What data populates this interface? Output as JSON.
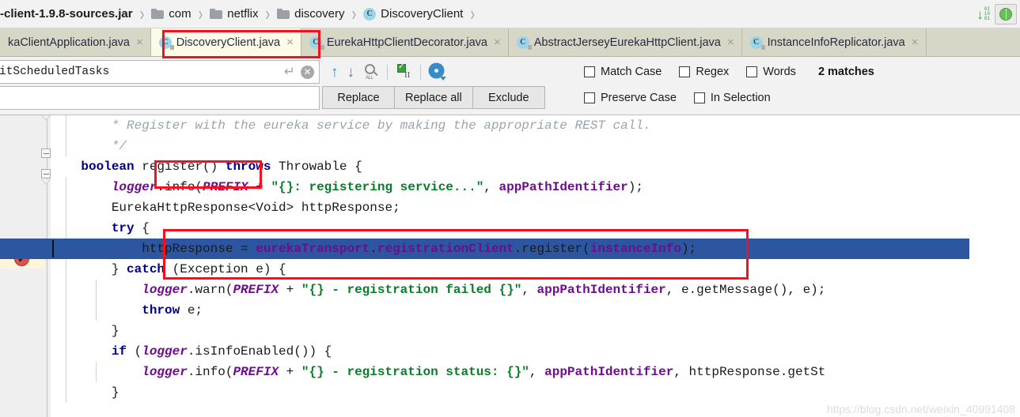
{
  "breadcrumb": {
    "items": [
      {
        "label": "-client-1.9.8-sources.jar",
        "icon": "none"
      },
      {
        "label": "com",
        "icon": "folder-icon"
      },
      {
        "label": "netflix",
        "icon": "folder-icon"
      },
      {
        "label": "discovery",
        "icon": "folder-icon"
      },
      {
        "label": "DiscoveryClient",
        "icon": "class-icon"
      }
    ],
    "separator": "›",
    "class_icon_letter": "C"
  },
  "topright": {
    "download_sources_icon": "download-bytecode-icon",
    "bits_line1": "01",
    "bits_line2": "10",
    "bits_line3": "01",
    "globe_icon": "globe-icon"
  },
  "tabs": [
    {
      "label": "kaClientApplication.java",
      "icon": "java-class-icon",
      "active": false,
      "close": "×"
    },
    {
      "label": "DiscoveryClient.java",
      "icon": "java-class-icon",
      "active": true,
      "close": "×"
    },
    {
      "label": "EurekaHttpClientDecorator.java",
      "icon": "java-class-icon",
      "active": false,
      "close": "×"
    },
    {
      "label": "AbstractJerseyEurekaHttpClient.java",
      "icon": "java-class-icon",
      "active": false,
      "close": "×"
    },
    {
      "label": "InstanceInfoReplicator.java",
      "icon": "java-class-icon",
      "active": false,
      "close": "×"
    }
  ],
  "find": {
    "search_value": "itScheduledTasks",
    "search_placeholder": "Search",
    "replace_value": "",
    "replace_placeholder": "Replace",
    "enter_icon": "↵",
    "clear_icon": "✕",
    "prev_icon": "↑",
    "next_icon": "↓",
    "find_all_icon": "find-all-icon",
    "find_all_label": "ALL",
    "select_all_occurrences_icon": "select-all-occurrences-icon",
    "settings_icon": "filter-settings-icon",
    "buttons": [
      {
        "label": "Replace"
      },
      {
        "label": "Replace all"
      },
      {
        "label": "Exclude"
      }
    ],
    "options_row1": [
      {
        "label": "Match Case",
        "checked": false
      },
      {
        "label": "Regex",
        "checked": false
      },
      {
        "label": "Words",
        "checked": false
      }
    ],
    "options_row2": [
      {
        "label": "Preserve Case",
        "checked": false
      },
      {
        "label": "In Selection",
        "checked": false
      }
    ],
    "match_count_text": "2 matches"
  },
  "gutter": {
    "breakpoint_icon": "breakpoint-verified-icon",
    "breakpoint_glyph": "✔",
    "fold_collapse_glyph": "−"
  },
  "code": {
    "language": "java",
    "lines": [
      {
        "indent": 2,
        "tokens": [
          {
            "t": "* Register with the eureka service by making the appropriate REST call.",
            "c": "cmt"
          }
        ]
      },
      {
        "indent": 2,
        "tokens": [
          {
            "t": "*/",
            "c": "cmt"
          }
        ]
      },
      {
        "indent": 1,
        "tokens": [
          {
            "t": "boolean",
            "c": "kw"
          },
          {
            "t": " register() ",
            "c": "plain"
          },
          {
            "t": "throws",
            "c": "kw"
          },
          {
            "t": " Throwable {",
            "c": "plain"
          }
        ]
      },
      {
        "indent": 2,
        "tokens": [
          {
            "t": "logger",
            "c": "fld"
          },
          {
            "t": ".info(",
            "c": "plain"
          },
          {
            "t": "PREFIX",
            "c": "fld"
          },
          {
            "t": " + ",
            "c": "plain"
          },
          {
            "t": "\"{}: registering service...\"",
            "c": "str"
          },
          {
            "t": ", ",
            "c": "plain"
          },
          {
            "t": "appPathIdentifier",
            "c": "fld-n"
          },
          {
            "t": ");",
            "c": "plain"
          }
        ]
      },
      {
        "indent": 2,
        "tokens": [
          {
            "t": "EurekaHttpResponse<Void> httpResponse;",
            "c": "plain"
          }
        ]
      },
      {
        "indent": 2,
        "tokens": [
          {
            "t": "try",
            "c": "kw"
          },
          {
            "t": " {",
            "c": "plain"
          }
        ]
      },
      {
        "indent": 3,
        "selected": true,
        "tokens": [
          {
            "t": "httpResponse = ",
            "c": "plain"
          },
          {
            "t": "eurekaTransport",
            "c": "fld-n"
          },
          {
            "t": ".",
            "c": "plain"
          },
          {
            "t": "registrationClient",
            "c": "fld-n"
          },
          {
            "t": ".register(",
            "c": "plain"
          },
          {
            "t": "instanceInfo",
            "c": "fld-n"
          },
          {
            "t": ");",
            "c": "plain"
          }
        ]
      },
      {
        "indent": 2,
        "tokens": [
          {
            "t": "} ",
            "c": "plain"
          },
          {
            "t": "catch",
            "c": "kw"
          },
          {
            "t": " (Exception e) {",
            "c": "plain"
          }
        ]
      },
      {
        "indent": 3,
        "tokens": [
          {
            "t": "logger",
            "c": "fld"
          },
          {
            "t": ".warn(",
            "c": "plain"
          },
          {
            "t": "PREFIX",
            "c": "fld"
          },
          {
            "t": " + ",
            "c": "plain"
          },
          {
            "t": "\"{} - registration failed {}\"",
            "c": "str"
          },
          {
            "t": ", ",
            "c": "plain"
          },
          {
            "t": "appPathIdentifier",
            "c": "fld-n"
          },
          {
            "t": ", e.getMessage(), e);",
            "c": "plain"
          }
        ]
      },
      {
        "indent": 3,
        "tokens": [
          {
            "t": "throw",
            "c": "kw"
          },
          {
            "t": " e;",
            "c": "plain"
          }
        ]
      },
      {
        "indent": 2,
        "tokens": [
          {
            "t": "}",
            "c": "plain"
          }
        ]
      },
      {
        "indent": 2,
        "tokens": [
          {
            "t": "if",
            "c": "kw"
          },
          {
            "t": " (",
            "c": "plain"
          },
          {
            "t": "logger",
            "c": "fld"
          },
          {
            "t": ".isInfoEnabled()) {",
            "c": "plain"
          }
        ]
      },
      {
        "indent": 3,
        "tokens": [
          {
            "t": "logger",
            "c": "fld"
          },
          {
            "t": ".info(",
            "c": "plain"
          },
          {
            "t": "PREFIX",
            "c": "fld"
          },
          {
            "t": " + ",
            "c": "plain"
          },
          {
            "t": "\"{} - registration status: {}\"",
            "c": "str"
          },
          {
            "t": ", ",
            "c": "plain"
          },
          {
            "t": "appPathIdentifier",
            "c": "fld-n"
          },
          {
            "t": ", httpResponse.getSt",
            "c": "plain"
          }
        ]
      },
      {
        "indent": 2,
        "tokens": [
          {
            "t": "}",
            "c": "plain"
          }
        ]
      }
    ]
  },
  "annotations": {
    "box_color": "#fc0d1b",
    "boxes": [
      {
        "name": "tab-highlight-box"
      },
      {
        "name": "register-method-box"
      },
      {
        "name": "register-call-line-box"
      }
    ]
  },
  "watermark": {
    "text": "https://blog.csdn.net/weixin_40991408"
  }
}
